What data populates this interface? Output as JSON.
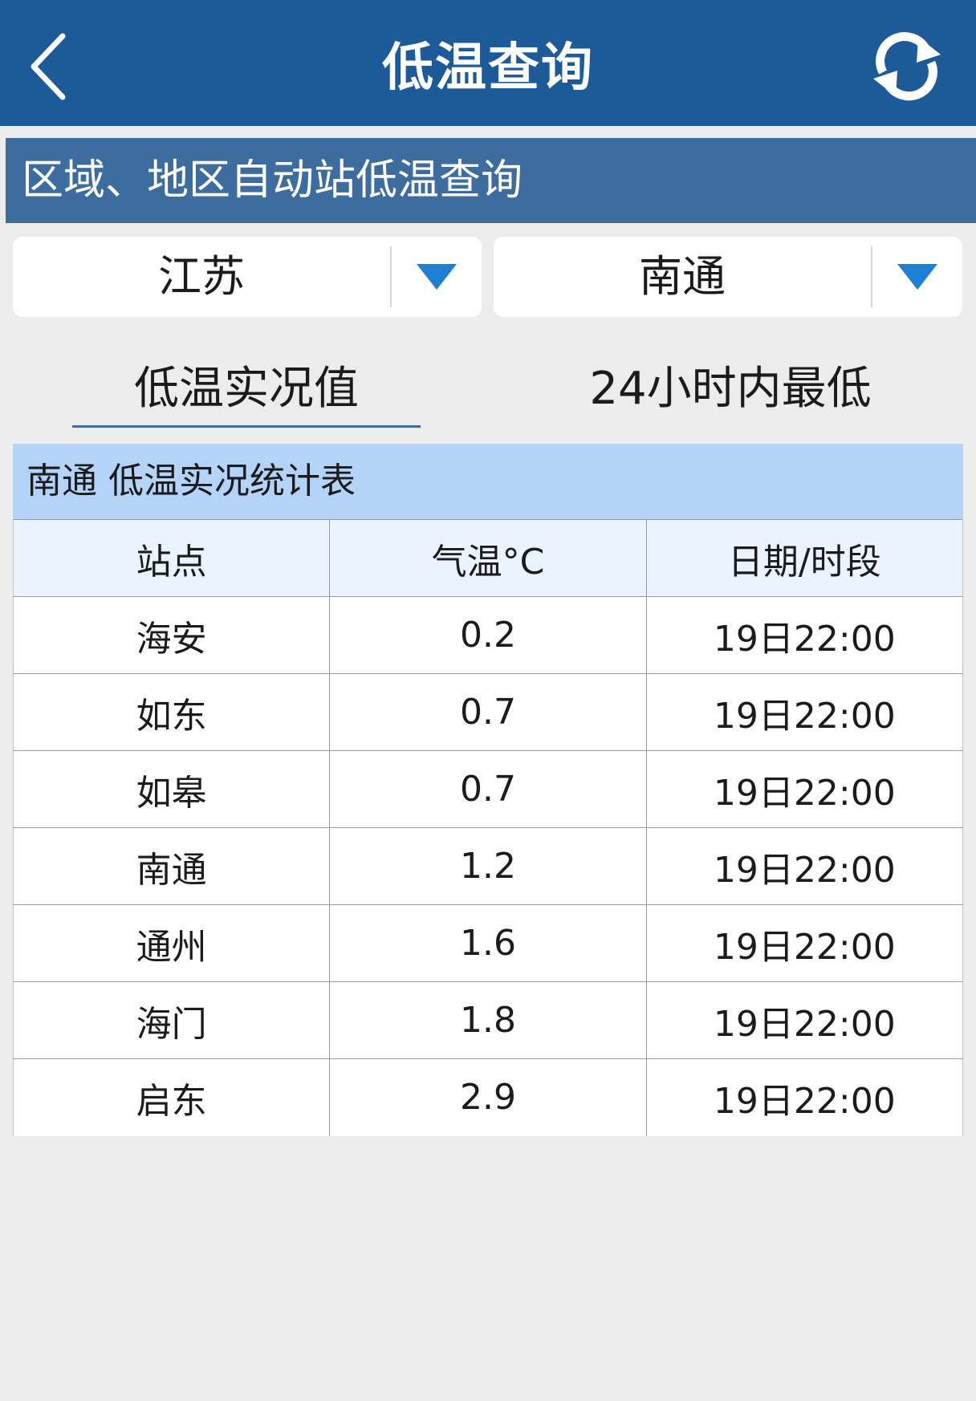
{
  "header": {
    "title": "低温查询",
    "back_icon": "chevron-left-icon",
    "refresh_icon": "refresh-icon"
  },
  "section": {
    "title": "区域、地区自动站低温查询"
  },
  "filters": {
    "province": "江苏",
    "city": "南通",
    "dropdown_icon": "triangle-down-icon",
    "accent_color": "#1e7fd6"
  },
  "tabs": [
    {
      "label": "低温实况值",
      "active": true
    },
    {
      "label": "24小时内最低",
      "active": false
    }
  ],
  "table": {
    "title": "南通 低温实况统计表",
    "columns": [
      "站点",
      "气温°C",
      "日期/时段"
    ],
    "rows": [
      [
        "海安",
        "0.2",
        "19日22:00"
      ],
      [
        "如东",
        "0.7",
        "19日22:00"
      ],
      [
        "如皋",
        "0.7",
        "19日22:00"
      ],
      [
        "南通",
        "1.2",
        "19日22:00"
      ],
      [
        "通州",
        "1.6",
        "19日22:00"
      ],
      [
        "海门",
        "1.8",
        "19日22:00"
      ],
      [
        "启东",
        "2.9",
        "19日22:00"
      ]
    ]
  },
  "colors": {
    "topbar": "#1d5a9a",
    "section_header": "#3d6d9f",
    "table_title_bg": "#b3d3f8",
    "table_header_bg": "#eaf3fe",
    "page_bg": "#ececec"
  }
}
